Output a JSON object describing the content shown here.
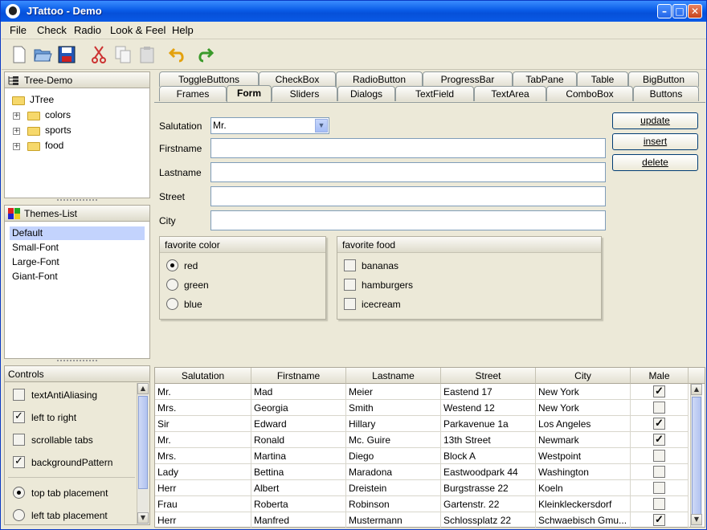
{
  "window": {
    "title": "JTattoo - Demo"
  },
  "menubar": [
    "File",
    "Check",
    "Radio",
    "Look & Feel",
    "Help"
  ],
  "tree": {
    "title": "Tree-Demo",
    "root": "JTree",
    "children": [
      "colors",
      "sports",
      "food"
    ]
  },
  "themes": {
    "title": "Themes-List",
    "items": [
      "Default",
      "Small-Font",
      "Large-Font",
      "Giant-Font"
    ],
    "selected": "Default"
  },
  "controls": {
    "title": "Controls",
    "checkboxes": [
      {
        "label": "textAntiAliasing",
        "checked": false
      },
      {
        "label": "left to right",
        "checked": true
      },
      {
        "label": "scrollable tabs",
        "checked": false
      },
      {
        "label": "backgroundPattern",
        "checked": true
      }
    ],
    "radios": [
      {
        "label": "top tab placement",
        "checked": true
      },
      {
        "label": "left tab placement",
        "checked": false
      }
    ]
  },
  "tabs": {
    "row1": [
      "ToggleButtons",
      "CheckBox",
      "RadioButton",
      "ProgressBar",
      "TabPane",
      "Table",
      "BigButton"
    ],
    "row2": [
      "Frames",
      "Form",
      "Sliders",
      "Dialogs",
      "TextField",
      "TextArea",
      "ComboBox",
      "Buttons"
    ],
    "active": "Form"
  },
  "form": {
    "salutation_label": "Salutation",
    "salutation_value": "Mr.",
    "firstname_label": "Firstname",
    "lastname_label": "Lastname",
    "street_label": "Street",
    "city_label": "City",
    "buttons": {
      "update": "update",
      "insert": "insert",
      "delete": "delete"
    },
    "color_group": {
      "title": "favorite color",
      "options": [
        "red",
        "green",
        "blue"
      ],
      "selected": "red"
    },
    "food_group": {
      "title": "favorite food",
      "options": [
        "bananas",
        "hamburgers",
        "icecream"
      ]
    }
  },
  "table": {
    "columns": [
      "Salutation",
      "Firstname",
      "Lastname",
      "Street",
      "City",
      "Male"
    ],
    "rows": [
      [
        "Mr.",
        "Mad",
        "Meier",
        "Eastend 17",
        "New York",
        true
      ],
      [
        "Mrs.",
        "Georgia",
        "Smith",
        "Westend 12",
        "New York",
        false
      ],
      [
        "Sir",
        "Edward",
        "Hillary",
        "Parkavenue 1a",
        "Los Angeles",
        true
      ],
      [
        "Mr.",
        "Ronald",
        "Mc. Guire",
        "13th Street",
        "Newmark",
        true
      ],
      [
        "Mrs.",
        "Martina",
        "Diego",
        "Block A",
        "Westpoint",
        false
      ],
      [
        "Lady",
        "Bettina",
        "Maradona",
        "Eastwoodpark 44",
        "Washington",
        false
      ],
      [
        "Herr",
        "Albert",
        "Dreistein",
        "Burgstrasse 22",
        "Koeln",
        false
      ],
      [
        "Frau",
        "Roberta",
        "Robinson",
        "Gartenstr. 22",
        "Kleinkleckersdorf",
        false
      ],
      [
        "Herr",
        "Manfred",
        "Mustermann",
        "Schlossplatz 22",
        "Schwaebisch Gmu...",
        true
      ]
    ]
  }
}
